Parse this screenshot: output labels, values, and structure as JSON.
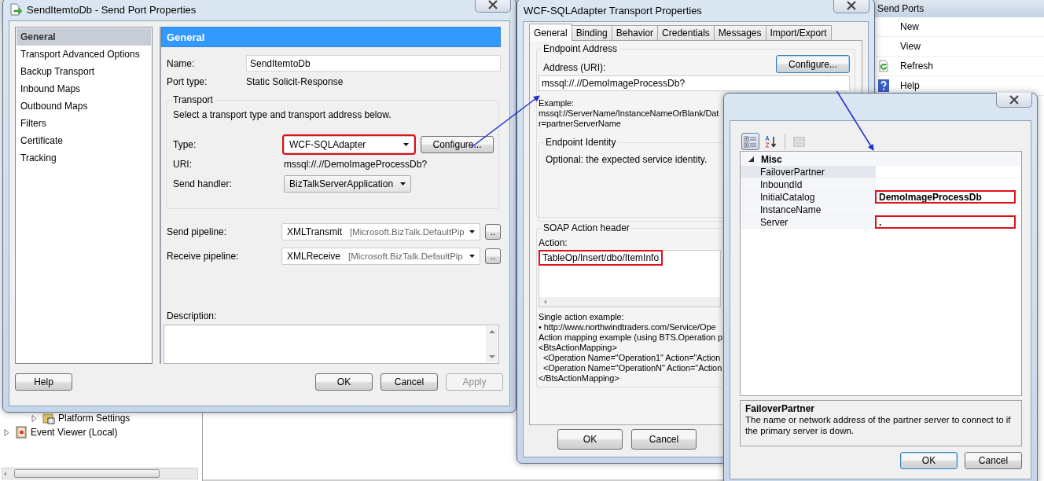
{
  "console": {
    "tree": [
      {
        "label": "Platform Settings",
        "kind": "settings"
      },
      {
        "label": "Event Viewer (Local)",
        "kind": "viewer"
      }
    ],
    "actions": {
      "title": "Send Ports",
      "items": [
        {
          "label": "New",
          "kind": "plain"
        },
        {
          "label": "View",
          "kind": "plain"
        },
        {
          "label": "Refresh",
          "kind": "refresh"
        },
        {
          "label": "Help",
          "kind": "help"
        }
      ]
    }
  },
  "send_port_window": {
    "title": "SendItemtoDb - Send Port Properties",
    "nav": [
      {
        "label": "General",
        "selected": true
      },
      {
        "label": "Transport Advanced Options",
        "selected": false
      },
      {
        "label": "Backup Transport",
        "selected": false
      },
      {
        "label": "Inbound Maps",
        "selected": false
      },
      {
        "label": "Outbound Maps",
        "selected": false
      },
      {
        "label": "Filters",
        "selected": false
      },
      {
        "label": "Certificate",
        "selected": false
      },
      {
        "label": "Tracking",
        "selected": false
      }
    ],
    "section_title": "General",
    "name": {
      "label": "Name:",
      "value": "SendItemtoDb"
    },
    "port_type": {
      "label": "Port type:",
      "value": "Static Solicit-Response"
    },
    "transport": {
      "legend": "Transport",
      "hint": "Select a transport type and transport address below.",
      "type": {
        "label": "Type:",
        "value": "WCF-SQLAdapter",
        "highlighted": true
      },
      "configure": "Configure...",
      "uri": {
        "label": "URI:",
        "value": "mssql://.//DemoImageProcessDb?"
      },
      "send_handler": {
        "label": "Send handler:",
        "value": "BizTalkServerApplication"
      }
    },
    "pipelines": [
      {
        "label": "Send pipeline:",
        "value": "XMLTransmit",
        "assembly": "[Microsoft.BizTalk.DefaultPip",
        "browse": ".."
      },
      {
        "label": "Receive pipeline:",
        "value": "XMLReceive",
        "assembly": "[Microsoft.BizTalk.DefaultPip",
        "browse": ".."
      }
    ],
    "description": {
      "label": "Description:"
    },
    "buttons": [
      {
        "label": "Help",
        "disabled": false
      },
      {
        "label": "OK",
        "disabled": false
      },
      {
        "label": "Cancel",
        "disabled": false
      },
      {
        "label": "Apply",
        "disabled": true
      }
    ]
  },
  "transport_window": {
    "title": "WCF-SQLAdapter Transport Properties",
    "tabs": [
      {
        "label": "General",
        "selected": true
      },
      {
        "label": "Binding",
        "selected": false
      },
      {
        "label": "Behavior",
        "selected": false
      },
      {
        "label": "Credentials",
        "selected": false
      },
      {
        "label": "Messages",
        "selected": false
      },
      {
        "label": "Import/Export",
        "selected": false
      }
    ],
    "endpoint_address": {
      "legend": "Endpoint Address",
      "address_label": "Address (URI):",
      "configure": "Configure...",
      "address": "mssql://.//DemoImageProcessDb?",
      "example": [
        "Example:",
        "mssql://ServerName/InstanceNameOrBlank/Dat",
        "r=partnerServerName"
      ]
    },
    "endpoint_identity": {
      "legend": "Endpoint Identity",
      "text": "Optional: the expected service identity."
    },
    "soap_action": {
      "legend": "SOAP Action header",
      "action_label": "Action:",
      "action": {
        "value": "TableOp/Insert/dbo/ItemInfo",
        "highlighted": true
      },
      "examples": [
        "Single action example:",
        "• http://www.northwindtraders.com/Service/Ope",
        "Action mapping example (using BTS.Operation p",
        "<BtsActionMapping>",
        "  <Operation Name=\"Operation1\" Action=\"Action",
        "  <Operation Name=\"OperationN\" Action=\"Action",
        "</BtsActionMapping>"
      ]
    },
    "buttons": [
      {
        "label": "OK"
      },
      {
        "label": "Cancel"
      }
    ]
  },
  "properties_window": {
    "toolbar": [
      {
        "kind": "categorized",
        "selected": true
      },
      {
        "kind": "alphabetical",
        "selected": false
      },
      {
        "kind": "pages",
        "selected": false
      }
    ],
    "category": {
      "label": "Misc",
      "expanded": true,
      "rows": [
        {
          "name": "FailoverPartner",
          "selected": true,
          "highlighted": false
        },
        {
          "name": "InboundId",
          "selected": false,
          "highlighted": false
        },
        {
          "name": "InitialCatalog",
          "value": "DemoImageProcessDb",
          "selected": false,
          "highlighted": true
        },
        {
          "name": "InstanceName",
          "selected": false,
          "highlighted": false
        },
        {
          "name": "Server",
          "value": ".",
          "selected": false,
          "highlighted": true
        }
      ]
    },
    "description": {
      "title": "FailoverPartner",
      "text": "The name or network address of the partner server to connect to if the primary server is down."
    },
    "buttons": [
      {
        "label": "OK",
        "default": true
      },
      {
        "label": "Cancel",
        "default": false
      }
    ]
  }
}
